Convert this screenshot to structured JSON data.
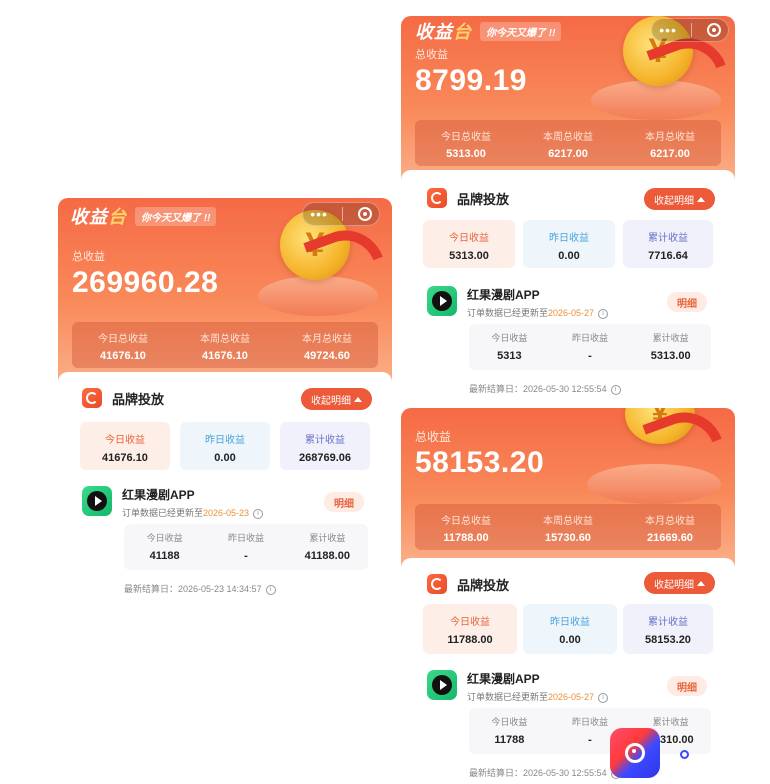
{
  "cards": [
    {
      "brand_title_1": "收益",
      "brand_title_2": "台",
      "slogan": "你今天又爆了 !!",
      "total_label": "总收益",
      "total_value": "269960.28",
      "stats": [
        {
          "label": "今日总收益",
          "value": "41676.10"
        },
        {
          "label": "本周总收益",
          "value": "41676.10"
        },
        {
          "label": "本月总收益",
          "value": "49724.60"
        }
      ],
      "section_title": "品牌投放",
      "collapse_label": "收起明细",
      "metrics": [
        {
          "label": "今日收益",
          "value": "41676.10"
        },
        {
          "label": "昨日收益",
          "value": "0.00"
        },
        {
          "label": "累计收益",
          "value": "268769.06"
        }
      ],
      "app_name": "红果漫剧APP",
      "app_sub_prefix": "订单数据已经更新至",
      "app_sub_date": "2026-05-23",
      "detail_label": "明细",
      "sub_stats": [
        {
          "label": "今日收益",
          "value": "41188"
        },
        {
          "label": "昨日收益",
          "value": "-"
        },
        {
          "label": "累计收益",
          "value": "41188.00"
        }
      ],
      "settle_label": "最新结算日：2026-05-23 14:34:57"
    },
    {
      "brand_title_1": "收益",
      "brand_title_2": "台",
      "slogan": "你今天又爆了 !!",
      "total_label": "总收益",
      "total_value": "8799.19",
      "stats": [
        {
          "label": "今日总收益",
          "value": "5313.00"
        },
        {
          "label": "本周总收益",
          "value": "6217.00"
        },
        {
          "label": "本月总收益",
          "value": "6217.00"
        }
      ],
      "section_title": "品牌投放",
      "collapse_label": "收起明细",
      "metrics": [
        {
          "label": "今日收益",
          "value": "5313.00"
        },
        {
          "label": "昨日收益",
          "value": "0.00"
        },
        {
          "label": "累计收益",
          "value": "7716.64"
        }
      ],
      "app_name": "红果漫剧APP",
      "app_sub_prefix": "订单数据已经更新至",
      "app_sub_date": "2026-05-27",
      "detail_label": "明细",
      "sub_stats": [
        {
          "label": "今日收益",
          "value": "5313"
        },
        {
          "label": "昨日收益",
          "value": "-"
        },
        {
          "label": "累计收益",
          "value": "5313.00"
        }
      ],
      "settle_label": "最新结算日：2026-05-30 12:55:54"
    },
    {
      "total_label": "总收益",
      "total_value": "58153.20",
      "stats": [
        {
          "label": "今日总收益",
          "value": "11788.00"
        },
        {
          "label": "本周总收益",
          "value": "15730.60"
        },
        {
          "label": "本月总收益",
          "value": "21669.60"
        }
      ],
      "section_title": "品牌投放",
      "collapse_label": "收起明细",
      "metrics": [
        {
          "label": "今日收益",
          "value": "11788.00"
        },
        {
          "label": "昨日收益",
          "value": "0.00"
        },
        {
          "label": "累计收益",
          "value": "58153.20"
        }
      ],
      "app_name": "红果漫剧APP",
      "app_sub_prefix": "订单数据已经更新至",
      "app_sub_date": "2026-05-27",
      "detail_label": "明细",
      "sub_stats": [
        {
          "label": "今日收益",
          "value": "11788"
        },
        {
          "label": "昨日收益",
          "value": "-"
        },
        {
          "label": "累计收益",
          "value": "16310.00"
        }
      ],
      "settle_label": "最新结算日：2026-05-30 12:55:54"
    }
  ],
  "icons": {
    "coin": "yen-coin-icon",
    "menu": "more-dots-icon",
    "close": "target-close-icon",
    "brand": "brand-logo-icon",
    "app": "play-app-icon",
    "info": "info-icon",
    "float": "assistant-float-icon"
  },
  "colors": {
    "header_orange": "#f56a45",
    "accent_red": "#ec5a3a",
    "date_orange": "#e8923a"
  },
  "coin_symbol": "¥"
}
